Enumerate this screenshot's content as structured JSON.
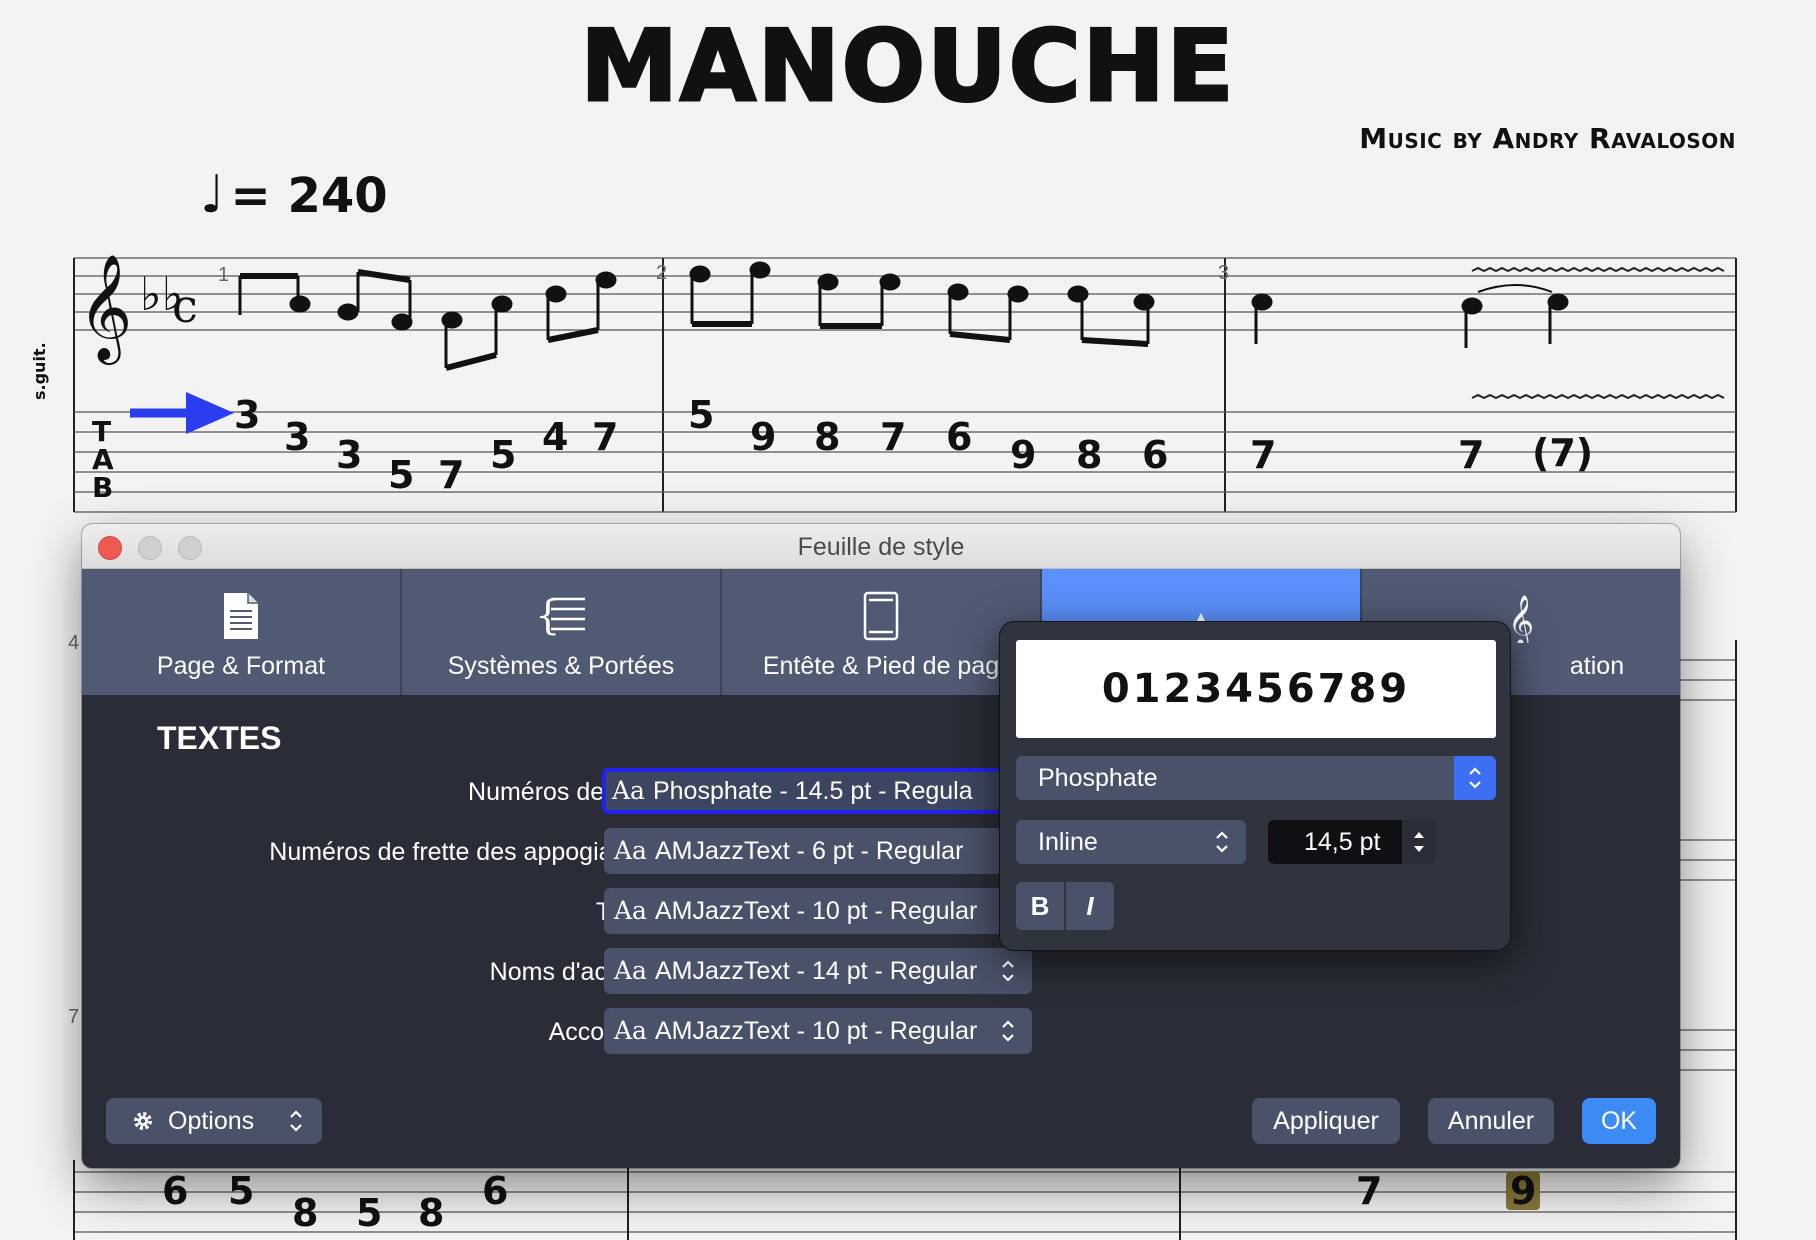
{
  "score": {
    "title": "MANOUCHE",
    "composer": "Music by Andry Ravaloson",
    "tempo_note": "♩",
    "tempo_value": "= 240",
    "instrument": "s.guit.",
    "tab_clef": [
      "T",
      "A",
      "B"
    ],
    "measure_numbers": [
      "1",
      "2",
      "3",
      "4",
      "7"
    ],
    "fret_numbers_row1": [
      "3",
      "3",
      "3",
      "5",
      "7",
      "5",
      "4",
      "7",
      "5",
      "9",
      "8",
      "7",
      "6",
      "9",
      "8",
      "6",
      "7",
      "7",
      "(7)"
    ],
    "fret_numbers_bottom": [
      "6",
      "5",
      "8",
      "5",
      "8",
      "6",
      "7",
      "9"
    ]
  },
  "dialog": {
    "title": "Feuille de style",
    "tabs": [
      {
        "label": "Page & Format",
        "icon": "page-icon"
      },
      {
        "label": "Systèmes & Portées",
        "icon": "staff-systems-icon"
      },
      {
        "label": "Entête & Pied de pag",
        "icon": "header-footer-icon"
      },
      {
        "label": "",
        "icon": "text-style-icon",
        "active": true
      },
      {
        "label": "ation",
        "icon": "treble-clef-icon"
      }
    ],
    "section_title": "TEXTES",
    "rows": [
      {
        "label": "Numéros de frette :",
        "aa": "Aa",
        "value": "Phosphate - 14.5 pt - Regula"
      },
      {
        "label": "Numéros de frette des appogiatures :",
        "aa": "Aa",
        "value": "AMJazzText - 6 pt - Regular"
      },
      {
        "label": "Textes :",
        "aa": "Aa",
        "value": "AMJazzText - 10 pt - Regular"
      },
      {
        "label": "Noms d'accords :",
        "aa": "Aa",
        "value": "AMJazzText - 14 pt - Regular"
      },
      {
        "label": "Accordage :",
        "aa": "Aa",
        "value": "AMJazzText - 10 pt - Regular"
      }
    ],
    "options_label": "Options",
    "apply_label": "Appliquer",
    "cancel_label": "Annuler",
    "ok_label": "OK"
  },
  "popover": {
    "preview_text": "0123456789",
    "font_family": "Phosphate",
    "font_style": "Inline",
    "font_size": "14,5 pt",
    "bold_label": "B",
    "italic_label": "I"
  },
  "colors": {
    "accent": "#5b8ff9",
    "ok_button": "#3d8bf5",
    "focus_ring": "#2222ee",
    "dialog_bg": "#2a2d37",
    "tab_bar": "#505a73"
  }
}
